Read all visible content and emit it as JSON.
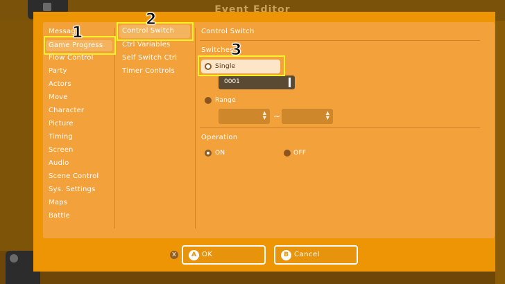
{
  "background": {
    "title": "Event Editor"
  },
  "dialog": {
    "categories": [
      {
        "label": "Message",
        "selected": false
      },
      {
        "label": "Game Progress",
        "selected": true
      },
      {
        "label": "Flow Control",
        "selected": false
      },
      {
        "label": "Party",
        "selected": false
      },
      {
        "label": "Actors",
        "selected": false
      },
      {
        "label": "Move",
        "selected": false
      },
      {
        "label": "Character",
        "selected": false
      },
      {
        "label": "Picture",
        "selected": false
      },
      {
        "label": "Timing",
        "selected": false
      },
      {
        "label": "Screen",
        "selected": false
      },
      {
        "label": "Audio",
        "selected": false
      },
      {
        "label": "Scene Control",
        "selected": false
      },
      {
        "label": "Sys. Settings",
        "selected": false
      },
      {
        "label": "Maps",
        "selected": false
      },
      {
        "label": "Battle",
        "selected": false
      }
    ],
    "commands": [
      {
        "label": "Control Switch",
        "selected": true
      },
      {
        "label": "Ctrl Variables",
        "selected": false
      },
      {
        "label": "Self Switch Ctrl",
        "selected": false
      },
      {
        "label": "Timer Controls",
        "selected": false
      }
    ],
    "detail": {
      "title": "Control Switch",
      "switches_label": "Switches",
      "single_label": "Single",
      "single_value": "0001",
      "range_label": "Range",
      "range_from": "",
      "range_to": "",
      "range_separator": "~",
      "operation_label": "Operation",
      "on_label": "ON",
      "off_label": "OFF"
    },
    "footer": {
      "cancel_hint": "X",
      "ok_badge": "A",
      "ok_label": "OK",
      "cancel_badge": "B",
      "cancel_label": "Cancel"
    },
    "annotations": [
      "1",
      "2",
      "3"
    ],
    "colors": {
      "dialog": "#ee9506",
      "panel": "#f3a13a",
      "highlight": "#f7f32a",
      "selected_item": "#f4b45f"
    }
  }
}
